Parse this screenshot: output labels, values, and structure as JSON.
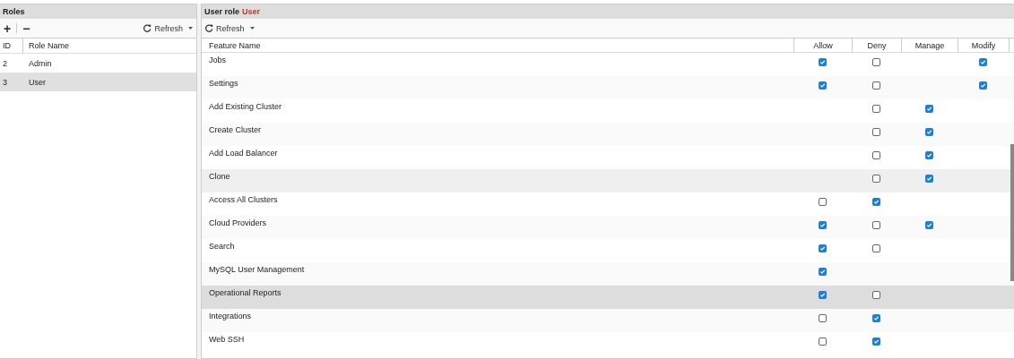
{
  "roles_panel": {
    "title": "Roles",
    "toolbar": {
      "add": "+",
      "remove": "−",
      "refresh": "Refresh"
    },
    "columns": [
      "ID",
      "Role Name"
    ],
    "rows": [
      {
        "id": "2",
        "name": "Admin",
        "selected": false
      },
      {
        "id": "3",
        "name": "User",
        "selected": true
      }
    ]
  },
  "permissions_panel": {
    "title": "User role",
    "role": "User",
    "toolbar": {
      "refresh": "Refresh"
    },
    "columns": [
      "Feature Name",
      "Allow",
      "Deny",
      "Manage",
      "Modify"
    ],
    "rows": [
      {
        "feature": "Jobs",
        "selected": false,
        "hovered": false,
        "allow": true,
        "deny": false,
        "modify": true
      },
      {
        "feature": "Settings",
        "selected": false,
        "hovered": false,
        "allow": true,
        "deny": false,
        "modify": true
      },
      {
        "feature": "Add Existing Cluster",
        "selected": false,
        "hovered": false,
        "deny": false,
        "manage": true
      },
      {
        "feature": "Create Cluster",
        "selected": false,
        "hovered": false,
        "deny": false,
        "manage": true
      },
      {
        "feature": "Add Load Balancer",
        "selected": false,
        "hovered": false,
        "deny": false,
        "manage": true
      },
      {
        "feature": "Clone",
        "selected": false,
        "hovered": true,
        "deny": false,
        "manage": true
      },
      {
        "feature": "Access All Clusters",
        "selected": false,
        "hovered": false,
        "allow": false,
        "deny": true
      },
      {
        "feature": "Cloud Providers",
        "selected": false,
        "hovered": false,
        "allow": true,
        "deny": false,
        "manage": true
      },
      {
        "feature": "Search",
        "selected": false,
        "hovered": false,
        "allow": true,
        "deny": false
      },
      {
        "feature": "MySQL User Management",
        "selected": false,
        "hovered": false,
        "allow": true
      },
      {
        "feature": "Operational Reports",
        "selected": true,
        "hovered": false,
        "allow": true,
        "deny": false
      },
      {
        "feature": "Integrations",
        "selected": false,
        "hovered": false,
        "allow": false,
        "deny": true
      },
      {
        "feature": "Web SSH",
        "selected": false,
        "hovered": false,
        "allow": false,
        "deny": true
      }
    ]
  }
}
